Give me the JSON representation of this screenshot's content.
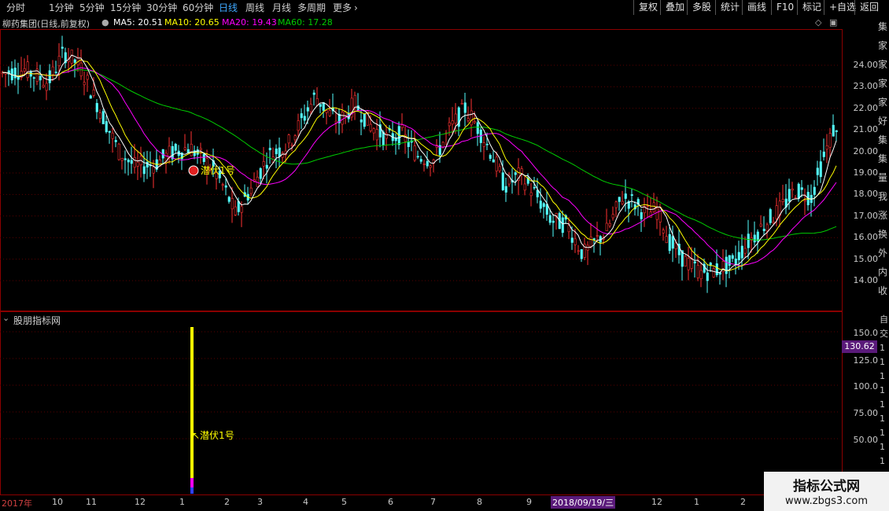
{
  "toolbar": {
    "tabs": [
      "分时",
      "1分钟",
      "5分钟",
      "15分钟",
      "30分钟",
      "60分钟",
      "日线",
      "周线",
      "月线",
      "多周期",
      "更多"
    ],
    "active_tab": "日线",
    "right_buttons": [
      "复权",
      "叠加",
      "多股",
      "统计",
      "画线",
      "F10",
      "标记",
      "+自选",
      "返回"
    ]
  },
  "info": {
    "title": "柳药集团(日线,前复权)",
    "ma5": "MA5: 20.51",
    "ma10": "MA10: 20.65",
    "ma20": "MA20: 19.43",
    "ma60": "MA60: 17.28"
  },
  "main_chart": {
    "price_labels": [
      "24.00",
      "23.00",
      "22.00",
      "21.00",
      "20.00",
      "19.00",
      "18.00",
      "17.00",
      "16.00",
      "15.00",
      "14.00"
    ],
    "signal_label": "潜伏1号"
  },
  "indicator": {
    "title": "股朋指标网",
    "labels": [
      "150.0",
      "125.0",
      "100.0",
      "75.00",
      "50.00"
    ],
    "current_value": "130.62",
    "signal_label": "潜伏1号"
  },
  "x_axis": {
    "labels": [
      "2017年",
      "10",
      "11",
      "12",
      "1",
      "2",
      "3",
      "4",
      "5",
      "6",
      "7",
      "8",
      "9",
      "12",
      "1",
      "2"
    ],
    "cursor_date": "2018/09/19/三"
  },
  "right_column": {
    "chars": [
      "集",
      "家",
      "家",
      "家",
      "家",
      "好",
      "集",
      "集",
      "量",
      "我",
      "涨",
      "换",
      "外",
      "内",
      "收"
    ],
    "lower_chars": [
      "自",
      "交",
      "1",
      "1",
      "1",
      "1",
      "1",
      "1",
      "1",
      "1",
      "1",
      "1"
    ]
  },
  "watermark": {
    "line1": "指标公式网",
    "line2": "www.zbgs3.com"
  },
  "chart_data": {
    "type": "candlestick",
    "ylim": [
      13.5,
      25
    ],
    "series": [
      {
        "name": "MA5",
        "color": "#ffffff"
      },
      {
        "name": "MA10",
        "color": "#ffff00"
      },
      {
        "name": "MA20",
        "color": "#ff00ff"
      },
      {
        "name": "MA60",
        "color": "#00cc00"
      }
    ]
  },
  "colors": {
    "up": "#ff3232",
    "down": "#54ffff",
    "frame": "#8b0000",
    "ma5": "#ffffff",
    "ma10": "#ffff00",
    "ma20": "#ff00ff",
    "ma60": "#00cc00",
    "active_tab": "#3fa9ff",
    "signal": "#ffff00",
    "value_badge": "#5a1a7a"
  }
}
